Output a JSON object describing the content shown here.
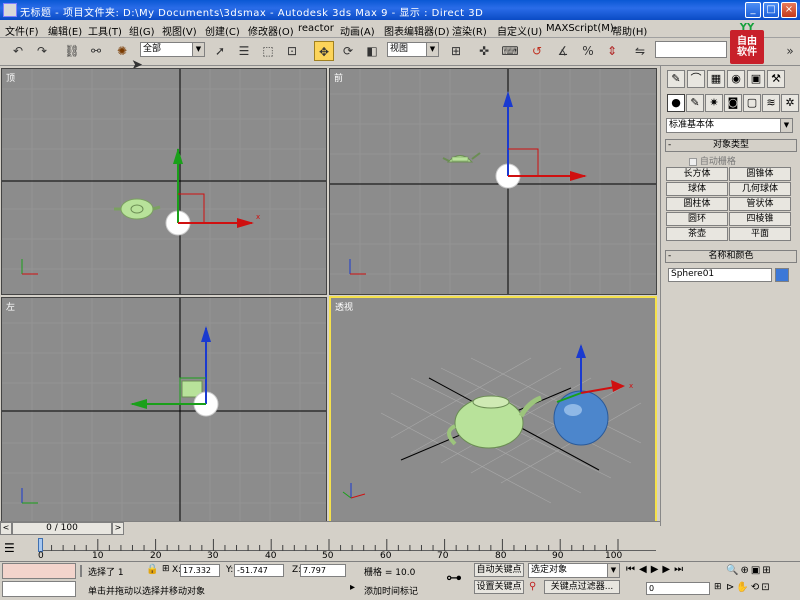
{
  "window": {
    "title": "无标题   - 项目文件夹: D:\\My Documents\\3dsmax    - Autodesk 3ds Max 9    - 显示 : Direct 3D",
    "controls": [
      "_",
      "□",
      "×"
    ]
  },
  "menu": [
    "文件(F)",
    "编辑(E)",
    "工具(T)",
    "组(G)",
    "视图(V)",
    "创建(C)",
    "修改器(O)",
    "reactor",
    "动画(A)",
    "图表编辑器(D)",
    "渲染(R)",
    "自定义(U)",
    "MAXScript(M)",
    "帮助(H)"
  ],
  "toolbar": {
    "selection_set": "全部",
    "ref_coord": "视图",
    "brand": {
      "top": "YY",
      "line1": "自由",
      "line2": "软件"
    }
  },
  "viewports": [
    {
      "label": "顶",
      "active": false
    },
    {
      "label": "前",
      "active": false
    },
    {
      "label": "左",
      "active": false
    },
    {
      "label": "透视",
      "active": true
    }
  ],
  "command_panel": {
    "category": "标准基本体",
    "object_type": {
      "header": "对象类型",
      "autogrid_label": "自动栅格",
      "buttons": [
        "长方体",
        "圆锥体",
        "球体",
        "几何球体",
        "圆柱体",
        "管状体",
        "圆环",
        "四棱锥",
        "茶壶",
        "平面"
      ]
    },
    "name_color": {
      "header": "名称和颜色",
      "name_value": "Sphere01",
      "color": "#3c78d8"
    }
  },
  "time": {
    "slider_label": "0 / 100",
    "ticks": [
      "0",
      "10",
      "20",
      "30",
      "40",
      "50",
      "60",
      "70",
      "80",
      "90",
      "100"
    ]
  },
  "status": {
    "selected": "选择了 1",
    "x_value": "17.332",
    "y_value": "-51.747",
    "z_value": "7.797",
    "grid": "栅格 = 10.0",
    "prompt": "单击并拖动以选择并移动对象",
    "add_time_tag": "添加时间标记",
    "auto_key": "自动关键点",
    "set_key": "设置关键点",
    "key_filter_combo": "选定对象",
    "key_filters": "关键点过滤器...",
    "frame": "0"
  },
  "colors": {
    "titlebar": "#0a58d4",
    "viewport_bg": "#8c8c8c",
    "teapot": "#b8e29a",
    "active_border": "#f5e14b"
  }
}
